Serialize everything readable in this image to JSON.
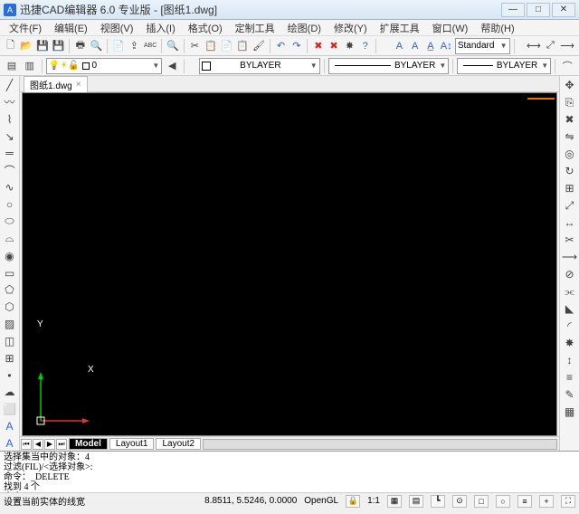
{
  "title": "迅捷CAD编辑器 6.0 专业版  - [图纸1.dwg]",
  "window": {
    "min": "—",
    "max": "□",
    "close": "✕"
  },
  "menu": [
    "文件(F)",
    "编辑(E)",
    "视图(V)",
    "插入(I)",
    "格式(O)",
    "定制工具",
    "绘图(D)",
    "修改(Y)",
    "扩展工具",
    "窗口(W)",
    "帮助(H)"
  ],
  "layer_combo": "0",
  "style_combo": "Standard",
  "bylayer1": "BYLAYER",
  "bylayer2": "BYLAYER",
  "bylayer3": "BYLAYER",
  "doc_tab": "图纸1.dwg",
  "layout_tabs": {
    "model": "Model",
    "l1": "Layout1",
    "l2": "Layout2"
  },
  "cmd": {
    "l1": "选择集当中的对象：4",
    "l2": "过滤(FIL)/<选择对象>:",
    "l3": "命令：_DELETE",
    "l4": "找到 4 个",
    "prompt": "命令:"
  },
  "status": {
    "hint": "设置当前实体的线宽",
    "coords": "8.8511, 5.5246, 0.0000",
    "render": "OpenGL",
    "scale": "1:1"
  },
  "ucs": {
    "x": "X",
    "y": "Y"
  }
}
